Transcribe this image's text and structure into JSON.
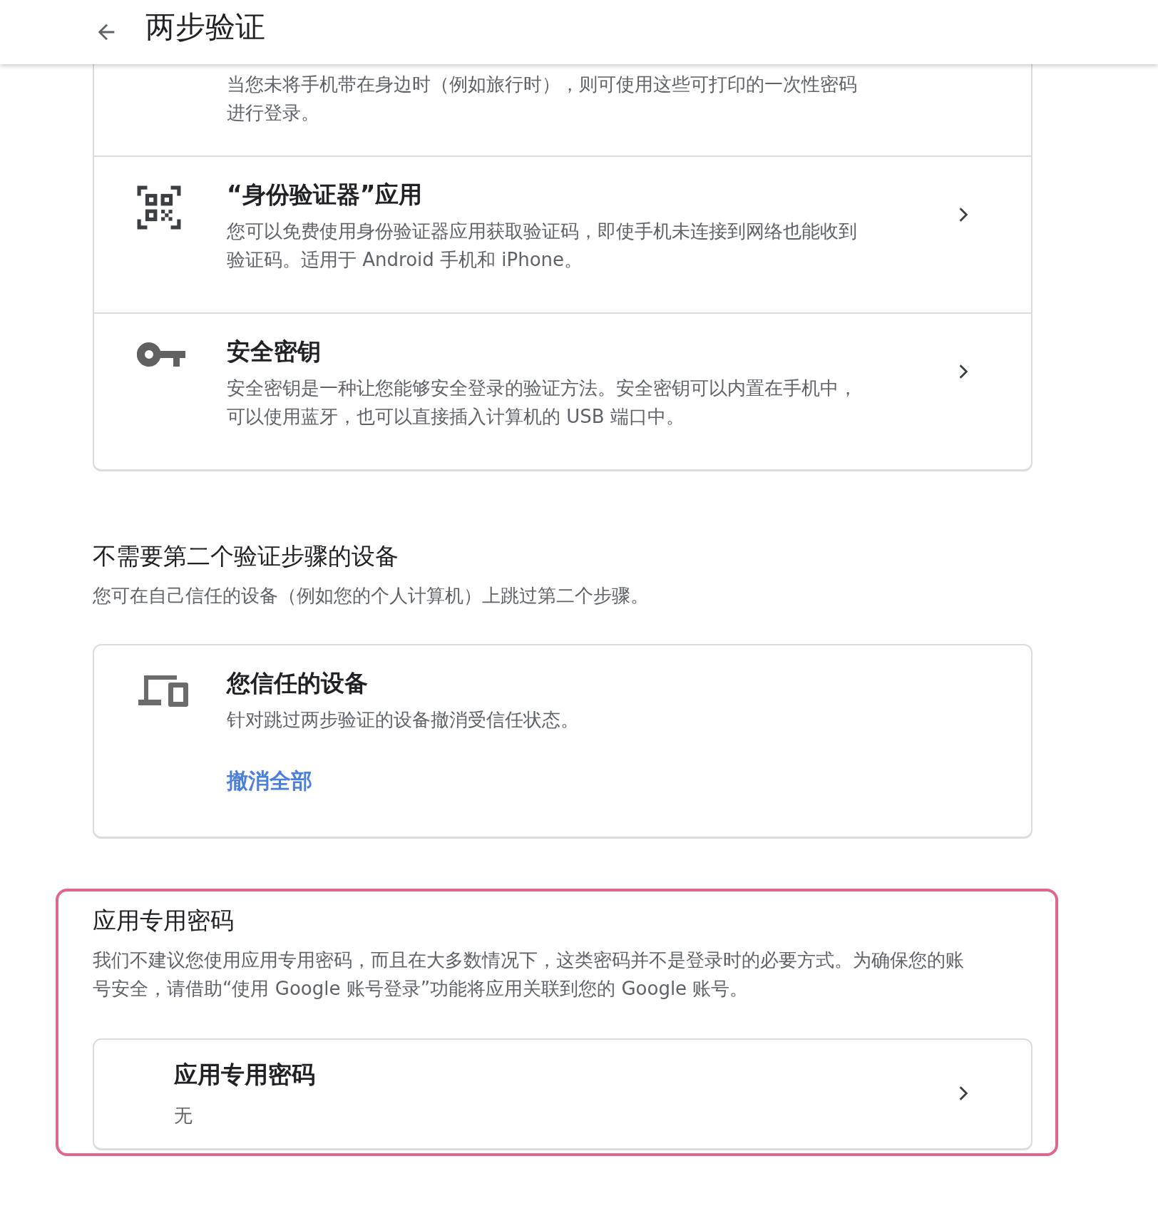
{
  "header": {
    "title": "两步验证"
  },
  "methods": [
    {
      "kind": "codes",
      "description": "当您未将手机带在身边时（例如旅行时），则可使用这些可打印的一次性密码进行登录。"
    },
    {
      "kind": "authenticator",
      "title": "“身份验证器”应用",
      "description": "您可以免费使用身份验证器应用获取验证码，即使手机未连接到网络也能收到验证码。适用于 Android 手机和 iPhone。"
    },
    {
      "kind": "security-key",
      "title": "安全密钥",
      "description": "安全密钥是一种让您能够安全登录的验证方法。安全密钥可以内置在手机中，可以使用蓝牙，也可以直接插入计算机的 USB 端口中。"
    }
  ],
  "trusted_section": {
    "heading": "不需要第二个验证步骤的设备",
    "description": "您可在自己信任的设备（例如您的个人计算机）上跳过第二个步骤。",
    "card": {
      "title": "您信任的设备",
      "description": "针对跳过两步验证的设备撤消受信任状态。",
      "link": "撤消全部"
    }
  },
  "app_passwords_section": {
    "highlighted": true,
    "heading": "应用专用密码",
    "description": "我们不建议您使用应用专用密码，而且在大多数情况下，这类密码并不是登录时的必要方式。为确保您的账号安全，请借助“使用 Google 账号登录”功能将应用关联到您的 Google 账号。",
    "card": {
      "title": "应用专用密码",
      "value": "无"
    }
  }
}
